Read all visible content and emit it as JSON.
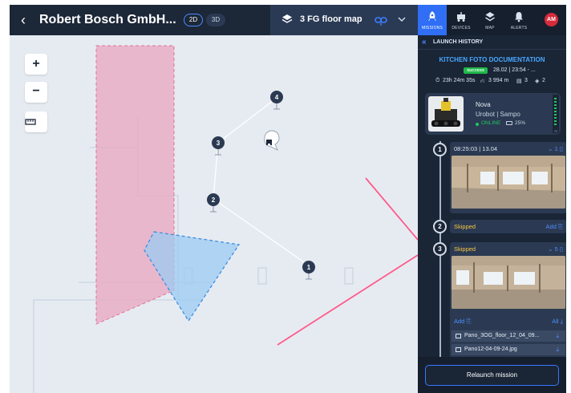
{
  "header": {
    "title": "Robert Bosch GmbH...",
    "view_2d": "2D",
    "view_3d": "3D",
    "floor_label": "3 FG floor map"
  },
  "map": {
    "zoom_in": "+",
    "zoom_out": "−",
    "waypoints": [
      "4",
      "3",
      "2",
      "1"
    ]
  },
  "nav": {
    "missions": "MISSIONS",
    "devices": "DEVICES",
    "map": "MAP",
    "alerts": "ALERTS",
    "avatar": "AM"
  },
  "launch_history": {
    "label": "LAUNCH HISTORY",
    "mission_title": "KITCHEN FOTO DOCUMENTATION",
    "status": "SUCCESS",
    "datetime": "28.02 | 23:54 - ...",
    "duration": "23h 24m 35s",
    "distance": "3 994 m",
    "photos": "3",
    "layers": "2"
  },
  "robot": {
    "name": "Nova",
    "model": "Urobot | Sampo",
    "status": "ONLINE",
    "battery": "25%",
    "signal": "72"
  },
  "steps": [
    {
      "number": "1",
      "time": "08:25:03 | 13.04",
      "count": "1"
    },
    {
      "number": "2",
      "status": "Skipped",
      "action": "Add"
    },
    {
      "number": "3",
      "status": "Skipped",
      "count": "5",
      "add_label": "Add",
      "all_label": "All",
      "files": [
        "Pano_3OG_floor_12_04_09...",
        "Pano12-04-09-24.jpg"
      ]
    }
  ],
  "relaunch_label": "Relaunch mission",
  "colors": {
    "accent": "#2f6ef5",
    "panel_bg": "#1a2536",
    "success": "#1fb94a",
    "skipped": "#f5c542",
    "zone_pink": "#e89bb6",
    "zone_blue": "#8ec4f0",
    "path_line": "#ff5a8a"
  }
}
